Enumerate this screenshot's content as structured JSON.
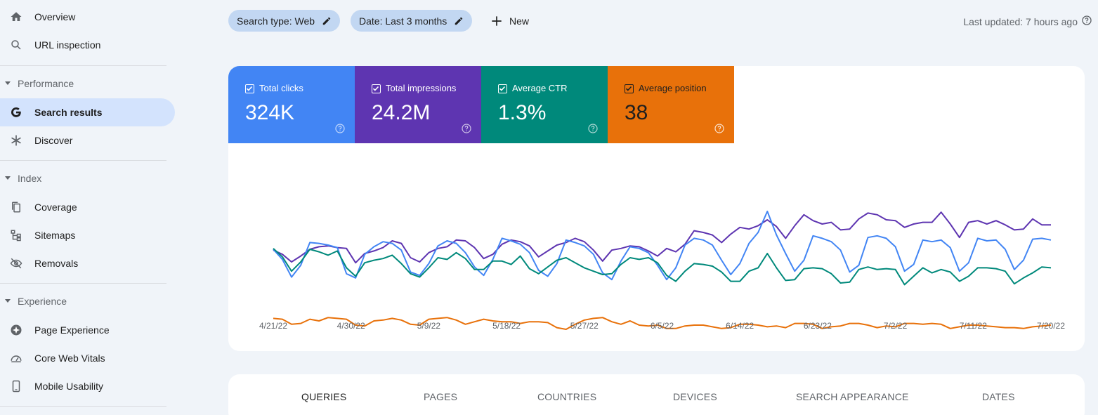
{
  "sidebar": {
    "items": [
      {
        "label": "Overview",
        "icon": "home-icon"
      },
      {
        "label": "URL inspection",
        "icon": "search-icon"
      }
    ],
    "sections": [
      {
        "title": "Performance",
        "items": [
          {
            "label": "Search results",
            "icon": "google-g-icon",
            "active": true
          },
          {
            "label": "Discover",
            "icon": "asterisk-icon"
          }
        ]
      },
      {
        "title": "Index",
        "items": [
          {
            "label": "Coverage",
            "icon": "copy-pages-icon"
          },
          {
            "label": "Sitemaps",
            "icon": "sitemap-icon"
          },
          {
            "label": "Removals",
            "icon": "eye-off-icon"
          }
        ]
      },
      {
        "title": "Experience",
        "items": [
          {
            "label": "Page Experience",
            "icon": "plus-circle-icon"
          },
          {
            "label": "Core Web Vitals",
            "icon": "gauge-icon"
          },
          {
            "label": "Mobile Usability",
            "icon": "phone-icon"
          }
        ]
      }
    ]
  },
  "toolbar": {
    "filters": [
      {
        "label": "Search type: Web"
      },
      {
        "label": "Date: Last 3 months"
      }
    ],
    "new_label": "New",
    "last_updated": "Last updated: 7 hours ago"
  },
  "metrics": [
    {
      "label": "Total clicks",
      "value": "324K",
      "color": "#4285f4",
      "checked": true
    },
    {
      "label": "Total impressions",
      "value": "24.2M",
      "color": "#5e35b1",
      "checked": true
    },
    {
      "label": "Average CTR",
      "value": "1.3%",
      "color": "#00897b",
      "checked": true
    },
    {
      "label": "Average position",
      "value": "38",
      "color": "#e8710a",
      "checked": true
    }
  ],
  "chart_data": {
    "type": "line",
    "x_tick_labels": [
      "4/21/22",
      "4/30/22",
      "5/9/22",
      "5/18/22",
      "5/27/22",
      "6/5/22",
      "6/14/22",
      "6/23/22",
      "7/2/22",
      "7/11/22",
      "7/20/22"
    ],
    "y_axis_labels_shown": false,
    "grid": false,
    "series": [
      {
        "name": "Total impressions",
        "color": "#5e35b1",
        "values": [
          0.44,
          0.39,
          0.3,
          0.37,
          0.45,
          0.48,
          0.49,
          0.47,
          0.46,
          0.29,
          0.4,
          0.43,
          0.47,
          0.55,
          0.52,
          0.35,
          0.3,
          0.41,
          0.46,
          0.48,
          0.56,
          0.55,
          0.47,
          0.34,
          0.39,
          0.51,
          0.56,
          0.54,
          0.49,
          0.36,
          0.43,
          0.5,
          0.53,
          0.58,
          0.54,
          0.44,
          0.31,
          0.44,
          0.46,
          0.49,
          0.48,
          0.43,
          0.37,
          0.46,
          0.42,
          0.51,
          0.67,
          0.65,
          0.62,
          0.53,
          0.63,
          0.71,
          0.69,
          0.73,
          0.8,
          0.72,
          0.58,
          0.73,
          0.86,
          0.79,
          0.75,
          0.77,
          0.68,
          0.69,
          0.81,
          0.88,
          0.86,
          0.8,
          0.79,
          0.71,
          0.75,
          0.77,
          0.77,
          0.89,
          0.75,
          0.59,
          0.77,
          0.79,
          0.75,
          0.79,
          0.74,
          0.68,
          0.69,
          0.81,
          0.74,
          0.74
        ]
      },
      {
        "name": "Total clicks",
        "color": "#4285f4",
        "values": [
          0.45,
          0.33,
          0.12,
          0.26,
          0.53,
          0.52,
          0.5,
          0.47,
          0.16,
          0.11,
          0.39,
          0.48,
          0.54,
          0.52,
          0.44,
          0.18,
          0.14,
          0.28,
          0.49,
          0.55,
          0.52,
          0.41,
          0.24,
          0.14,
          0.33,
          0.58,
          0.55,
          0.51,
          0.41,
          0.2,
          0.13,
          0.28,
          0.56,
          0.53,
          0.49,
          0.39,
          0.17,
          0.09,
          0.31,
          0.48,
          0.46,
          0.41,
          0.26,
          0.09,
          0.23,
          0.5,
          0.58,
          0.56,
          0.5,
          0.32,
          0.15,
          0.28,
          0.52,
          0.65,
          0.9,
          0.62,
          0.4,
          0.19,
          0.32,
          0.61,
          0.58,
          0.54,
          0.44,
          0.18,
          0.26,
          0.59,
          0.61,
          0.58,
          0.48,
          0.19,
          0.27,
          0.56,
          0.54,
          0.56,
          0.47,
          0.19,
          0.29,
          0.58,
          0.55,
          0.56,
          0.45,
          0.21,
          0.32,
          0.57,
          0.58,
          0.56
        ]
      },
      {
        "name": "Average CTR",
        "color": "#00897b",
        "values": [
          0.46,
          0.36,
          0.19,
          0.3,
          0.45,
          0.42,
          0.38,
          0.43,
          0.23,
          0.13,
          0.29,
          0.32,
          0.34,
          0.38,
          0.28,
          0.16,
          0.12,
          0.23,
          0.35,
          0.33,
          0.41,
          0.34,
          0.21,
          0.21,
          0.31,
          0.31,
          0.27,
          0.37,
          0.22,
          0.16,
          0.24,
          0.32,
          0.35,
          0.29,
          0.23,
          0.19,
          0.15,
          0.16,
          0.27,
          0.35,
          0.33,
          0.35,
          0.29,
          0.14,
          0.07,
          0.19,
          0.28,
          0.27,
          0.25,
          0.18,
          0.07,
          0.07,
          0.19,
          0.23,
          0.4,
          0.23,
          0.08,
          0.09,
          0.22,
          0.23,
          0.22,
          0.16,
          0.05,
          0.06,
          0.21,
          0.24,
          0.21,
          0.22,
          0.21,
          0.03,
          0.13,
          0.23,
          0.17,
          0.21,
          0.18,
          0.07,
          0.13,
          0.23,
          0.23,
          0.22,
          0.19,
          0.04,
          0.11,
          0.17,
          0.24,
          0.23
        ]
      },
      {
        "name": "Average position",
        "color": "#e8710a",
        "values": [
          -0.37,
          -0.38,
          -0.44,
          -0.43,
          -0.38,
          -0.4,
          -0.36,
          -0.37,
          -0.38,
          -0.45,
          -0.46,
          -0.4,
          -0.39,
          -0.37,
          -0.39,
          -0.44,
          -0.45,
          -0.38,
          -0.37,
          -0.36,
          -0.39,
          -0.44,
          -0.41,
          -0.38,
          -0.4,
          -0.41,
          -0.41,
          -0.43,
          -0.41,
          -0.41,
          -0.42,
          -0.48,
          -0.5,
          -0.44,
          -0.39,
          -0.37,
          -0.36,
          -0.41,
          -0.44,
          -0.4,
          -0.45,
          -0.46,
          -0.45,
          -0.49,
          -0.49,
          -0.46,
          -0.45,
          -0.45,
          -0.47,
          -0.49,
          -0.48,
          -0.44,
          -0.44,
          -0.45,
          -0.47,
          -0.46,
          -0.48,
          -0.43,
          -0.43,
          -0.44,
          -0.49,
          -0.47,
          -0.46,
          -0.43,
          -0.43,
          -0.45,
          -0.48,
          -0.46,
          -0.47,
          -0.43,
          -0.43,
          -0.44,
          -0.43,
          -0.44,
          -0.49,
          -0.47,
          -0.45,
          -0.45,
          -0.46,
          -0.47,
          -0.48,
          -0.48,
          -0.49,
          -0.47,
          -0.46,
          -0.45
        ]
      }
    ]
  },
  "tabs": [
    {
      "label": "QUERIES",
      "active": true
    },
    {
      "label": "PAGES"
    },
    {
      "label": "COUNTRIES"
    },
    {
      "label": "DEVICES"
    },
    {
      "label": "SEARCH APPEARANCE"
    },
    {
      "label": "DATES"
    }
  ]
}
